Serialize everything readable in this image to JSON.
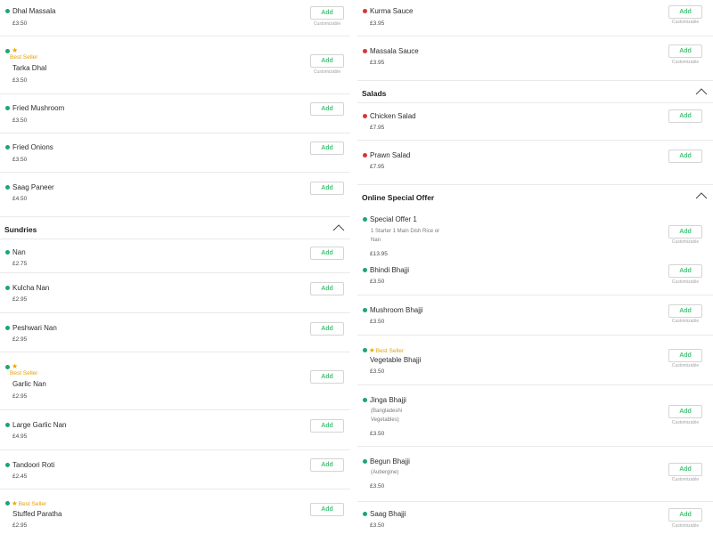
{
  "left": {
    "items": [
      {
        "name": "Dhal Massala",
        "price": "£3.50",
        "add": "Add",
        "customizable": "Customizable"
      },
      {
        "badge": "Best Seller",
        "name": "Tarka Dhal",
        "price": "£3.50",
        "add": "Add",
        "customizable": "Customizable"
      },
      {
        "name": "Fried Mushroom",
        "price": "£3.50",
        "add": "Add"
      },
      {
        "name": "Fried Onions",
        "price": "£3.50",
        "add": "Add"
      },
      {
        "name": "Saag Paneer",
        "price": "£4.50",
        "add": "Add"
      }
    ],
    "category": {
      "title": "Sundries"
    },
    "items2": [
      {
        "name": "Nan",
        "price": "£2.75",
        "add": "Add"
      },
      {
        "name": "Kulcha Nan",
        "price": "£2.95",
        "add": "Add"
      },
      {
        "name": "Peshwari Nan",
        "price": "£2.95",
        "add": "Add"
      },
      {
        "badge": "Best Seller",
        "name": "Garlic Nan",
        "price": "£2.95",
        "add": "Add"
      },
      {
        "name": "Large Garlic Nan",
        "price": "£4.95",
        "add": "Add"
      },
      {
        "name": "Tandoori Roti",
        "price": "£2.45",
        "add": "Add"
      },
      {
        "badge": "Best Seller",
        "name": "Stuffed Paratha",
        "price": "£2.95",
        "add": "Add"
      }
    ]
  },
  "right": {
    "items": [
      {
        "name": "Kurma Sauce",
        "price": "£3.95",
        "add": "Add",
        "customizable": "Customizable"
      },
      {
        "name": "Massala Sauce",
        "price": "£3.95",
        "add": "Add",
        "customizable": "Customizable"
      }
    ],
    "salads": {
      "title": "Salads",
      "items": [
        {
          "name": "Chicken Salad",
          "price": "£7.95",
          "add": "Add"
        },
        {
          "name": "Prawn Salad",
          "price": "£7.95",
          "add": "Add"
        }
      ]
    },
    "offer": {
      "title": "Online Special Offer",
      "items": [
        {
          "name": "Special Offer 1",
          "desc": "1 Starter 1 Main Dish Rice or Nan",
          "price": "£13.95",
          "add": "Add",
          "customizable": "Customizable"
        },
        {
          "name": "Bhindi Bhajji",
          "price": "£3.50",
          "add": "Add",
          "customizable": "Customizable"
        },
        {
          "name": "Mushroom Bhajji",
          "price": "£3.50",
          "add": "Add",
          "customizable": "Customizable"
        },
        {
          "badge": "Best Seller",
          "name": "Vegetable Bhajji",
          "price": "£3.50",
          "add": "Add",
          "customizable": "Customizable"
        },
        {
          "name": "Jinga Bhajji",
          "desc": "(Bangladeshi Vegetables)",
          "price": "£3.50",
          "add": "Add",
          "customizable": "Customizable"
        },
        {
          "name": "Begun Bhajji",
          "desc": "(Aubergine)",
          "price": "£3.50",
          "add": "Add",
          "customizable": "Customizable"
        },
        {
          "name": "Saag Bhajji",
          "price": "£3.50",
          "add": "Add",
          "customizable": "Customizable"
        }
      ]
    }
  },
  "colors": {
    "veg": "#1ba672",
    "nonveg": "#d63737",
    "accent": "#48c479",
    "bestseller": "#e5a100"
  },
  "icons": {
    "collapse": "chevron-up-icon",
    "star": "star-icon",
    "veg": "veg-indicator-icon",
    "nonveg": "non-veg-indicator-icon"
  }
}
